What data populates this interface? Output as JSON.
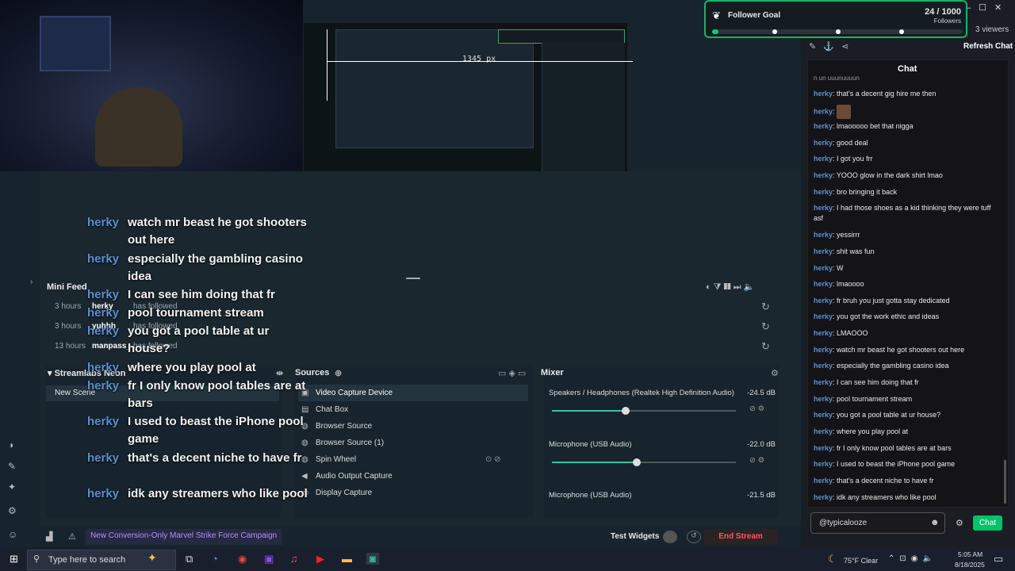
{
  "follower_goal": {
    "title": "Follower Goal",
    "count": "24 / 1000",
    "unit": "Followers",
    "progress": 0.024
  },
  "top_right": {
    "viewers": "3 viewers",
    "refresh_chat": "Refresh Chat",
    "chat_title": "Chat"
  },
  "preview": {
    "px_label": "1345 px"
  },
  "overlay_chat": [
    {
      "user": "herky",
      "msg": "watch mr beast he got shooters out here"
    },
    {
      "user": "herky",
      "msg": "especially the gambling casino idea"
    },
    {
      "user": "herky",
      "msg": "I can see him doing that fr"
    },
    {
      "user": "herky",
      "msg": "pool tournament stream"
    },
    {
      "user": "herky",
      "msg": "you got a pool table at ur house?"
    },
    {
      "user": "herky",
      "msg": "where you play pool at"
    },
    {
      "user": "herky",
      "msg": "fr I only know pool tables are at bars"
    },
    {
      "user": "herky",
      "msg": "I used to beast the iPhone pool game"
    },
    {
      "user": "herky",
      "msg": "that's a decent niche to have fr"
    },
    {
      "user": "herky",
      "msg": "idk any streamers who like pool"
    }
  ],
  "mini_feed": {
    "title": "Mini Feed",
    "rows": [
      {
        "time": "3 hours",
        "user": "herky",
        "action": "has followed"
      },
      {
        "time": "3 hours",
        "user": "yuhhh",
        "action": "has followed"
      },
      {
        "time": "13 hours",
        "user": "manpass_",
        "action": "has followed"
      }
    ]
  },
  "scenes": {
    "title": "Streamlabs Neon",
    "items": [
      "New Scene"
    ]
  },
  "sources": {
    "title": "Sources",
    "items": [
      "Video Capture Device",
      "Chat Box",
      "Browser Source",
      "Browser Source (1)",
      "Spin Wheel",
      "Audio Output Capture",
      "Display Capture"
    ]
  },
  "mixer": {
    "title": "Mixer",
    "channels": [
      {
        "name": "Speakers / Headphones (Realtek High Definition Audio)",
        "db": "-24.5 dB",
        "level": 0.4
      },
      {
        "name": "Microphone (USB Audio)",
        "db": "-22.0 dB",
        "level": 0.46
      },
      {
        "name": "Microphone (USB Audio)",
        "db": "-21.5 dB",
        "level": 0.48
      }
    ]
  },
  "bottom_bar": {
    "promo": "New Conversion-Only Marvel Strike Force Campaign",
    "test_widgets": "Test Widgets",
    "end_stream": "End Stream"
  },
  "chat": {
    "partial": "n un uuunuuuun",
    "messages": [
      {
        "user": "herky",
        "msg": "that's a decent gig hire me then"
      },
      {
        "user": "herky",
        "msg": ""
      },
      {
        "user": "herky",
        "msg": "lmaooooo bet that nigga"
      },
      {
        "user": "herky",
        "msg": "good deal"
      },
      {
        "user": "herky",
        "msg": "I got you frr"
      },
      {
        "user": "herky",
        "msg": "YOOO glow in the dark shirt lmao"
      },
      {
        "user": "herky",
        "msg": "bro bringing it back"
      },
      {
        "user": "herky",
        "msg": "I had those shoes as a kid thinking they were tuff asf"
      },
      {
        "user": "herky",
        "msg": "yessirrr"
      },
      {
        "user": "herky",
        "msg": "shit was fun"
      },
      {
        "user": "herky",
        "msg": "W"
      },
      {
        "user": "herky",
        "msg": "lmaoooo"
      },
      {
        "user": "herky",
        "msg": "fr bruh you just gotta stay dedicated"
      },
      {
        "user": "herky",
        "msg": "you got the work ethic and ideas"
      },
      {
        "user": "herky",
        "msg": "LMAOOO"
      },
      {
        "user": "herky",
        "msg": "watch mr beast he got shooters out here"
      },
      {
        "user": "herky",
        "msg": "especially the gambling casino idea"
      },
      {
        "user": "herky",
        "msg": "I can see him doing that fr"
      },
      {
        "user": "herky",
        "msg": "pool tournament stream"
      },
      {
        "user": "herky",
        "msg": "you got a pool table at ur house?"
      },
      {
        "user": "herky",
        "msg": "where you play pool at"
      },
      {
        "user": "herky",
        "msg": "fr I only know pool tables are at bars"
      },
      {
        "user": "herky",
        "msg": "I used to beast the iPhone pool game"
      },
      {
        "user": "herky",
        "msg": "that's a decent niche to have fr"
      },
      {
        "user": "herky",
        "msg": "idk any streamers who like pool"
      }
    ],
    "input_value": "@typicalooze",
    "send_label": "Chat"
  },
  "taskbar": {
    "search_placeholder": "Type here to search",
    "weather": "75°F  Clear",
    "time": "5:05 AM",
    "date": "8/18/2025"
  }
}
